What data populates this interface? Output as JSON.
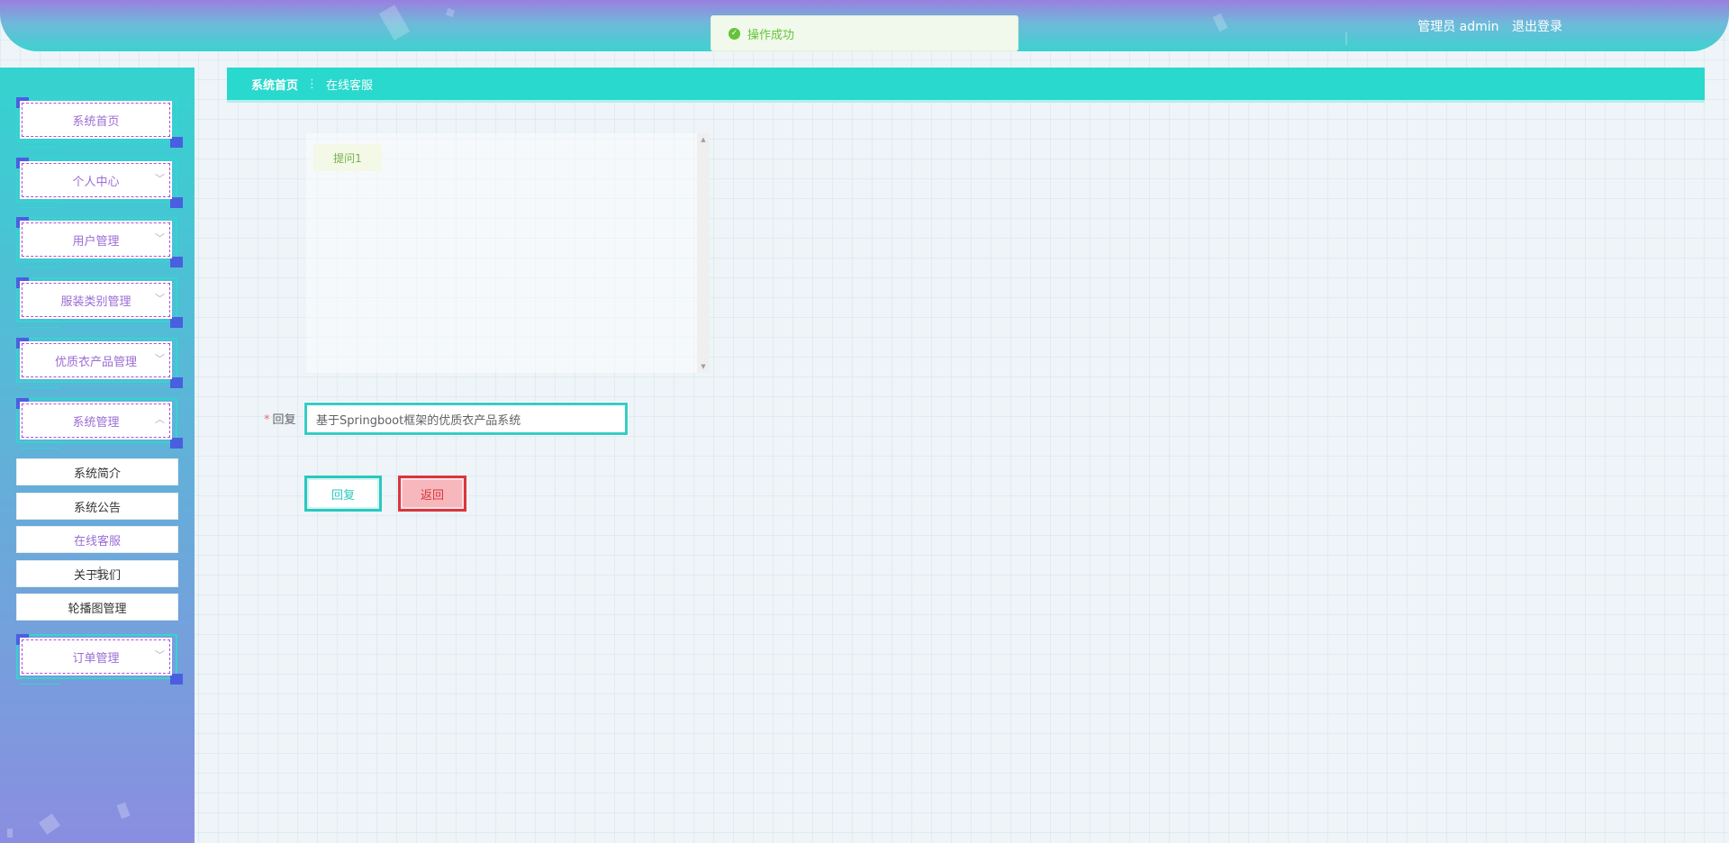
{
  "header": {
    "user_role_label": "管理员 admin",
    "logout_label": "退出登录"
  },
  "toast": {
    "message": "操作成功",
    "type": "success"
  },
  "sidebar": {
    "menu": [
      {
        "label": "系统首页",
        "chevron": ""
      },
      {
        "label": "个人中心",
        "chevron": "﹀"
      },
      {
        "label": "用户管理",
        "chevron": "﹀"
      },
      {
        "label": "服装类别管理",
        "chevron": "﹀"
      },
      {
        "label": "优质衣产品管理",
        "chevron": "﹀"
      },
      {
        "label": "系统管理",
        "chevron": "︿"
      }
    ],
    "submenu": [
      {
        "label": "系统简介"
      },
      {
        "label": "系统公告"
      },
      {
        "label": "在线客服",
        "active": true
      },
      {
        "label": "关于我们"
      },
      {
        "label": "轮播图管理"
      }
    ],
    "order_menu": {
      "label": "订单管理",
      "chevron": "﹀"
    }
  },
  "breadcrumb": {
    "home": "系统首页",
    "separator": "⋮",
    "current": "在线客服"
  },
  "chat": {
    "messages": [
      {
        "text": "提问1"
      }
    ]
  },
  "form": {
    "reply_label": "回复",
    "required_mark": "*",
    "reply_value": "基于Springboot框架的优质衣产品系统",
    "reply_button": "回复",
    "back_button": "返回"
  },
  "colors": {
    "accent_teal": "#2ad9cd",
    "menu_text_purple": "#9b6cd6",
    "success_green": "#67c23a",
    "back_red": "#d9363e"
  }
}
